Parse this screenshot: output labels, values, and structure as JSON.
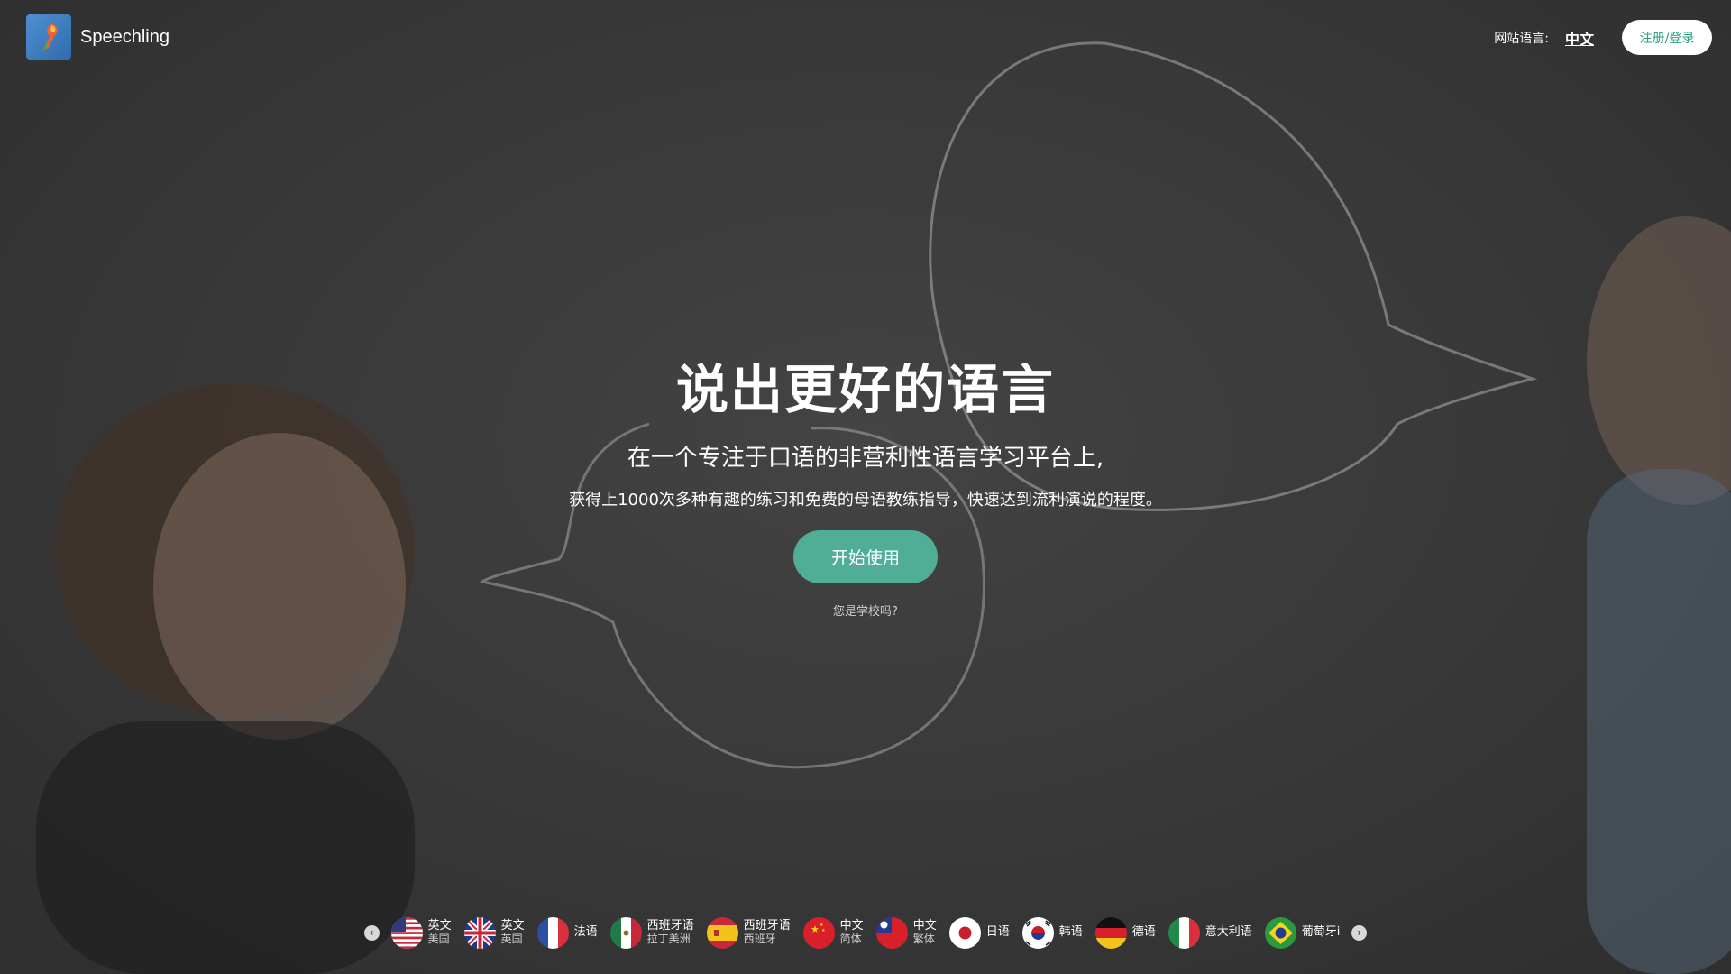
{
  "header": {
    "brand": "Speechling",
    "site_language_label": "网站语言:",
    "site_language_value": "中文",
    "signup_login": "注册/登录"
  },
  "hero": {
    "title": "说出更好的语言",
    "subtitle": "在一个专注于口语的非营利性语言学习平台上,",
    "description": "获得上1000次多种有趣的练习和免费的母语教练指导，快速达到流利演说的程度。",
    "cta": "开始使用",
    "school_link": "您是学校吗?"
  },
  "colors": {
    "accent": "#4fae95",
    "signup_text": "#2e9c82"
  },
  "languages": [
    {
      "main": "英文",
      "sub": "美国",
      "flag": "us-flag-icon"
    },
    {
      "main": "英文",
      "sub": "英国",
      "flag": "uk-flag-icon"
    },
    {
      "main": "法语",
      "sub": "",
      "flag": "france-flag-icon"
    },
    {
      "main": "西班牙语",
      "sub": "拉丁美洲",
      "flag": "mexico-flag-icon"
    },
    {
      "main": "西班牙语",
      "sub": "西班牙",
      "flag": "spain-flag-icon"
    },
    {
      "main": "中文",
      "sub": "简体",
      "flag": "china-flag-icon"
    },
    {
      "main": "中文",
      "sub": "繁体",
      "flag": "taiwan-flag-icon"
    },
    {
      "main": "日语",
      "sub": "",
      "flag": "japan-flag-icon"
    },
    {
      "main": "韩语",
      "sub": "",
      "flag": "korea-flag-icon"
    },
    {
      "main": "德语",
      "sub": "",
      "flag": "germany-flag-icon"
    },
    {
      "main": "意大利语",
      "sub": "",
      "flag": "italy-flag-icon"
    },
    {
      "main": "葡萄牙i",
      "sub": "",
      "flag": "brazil-flag-icon"
    }
  ]
}
